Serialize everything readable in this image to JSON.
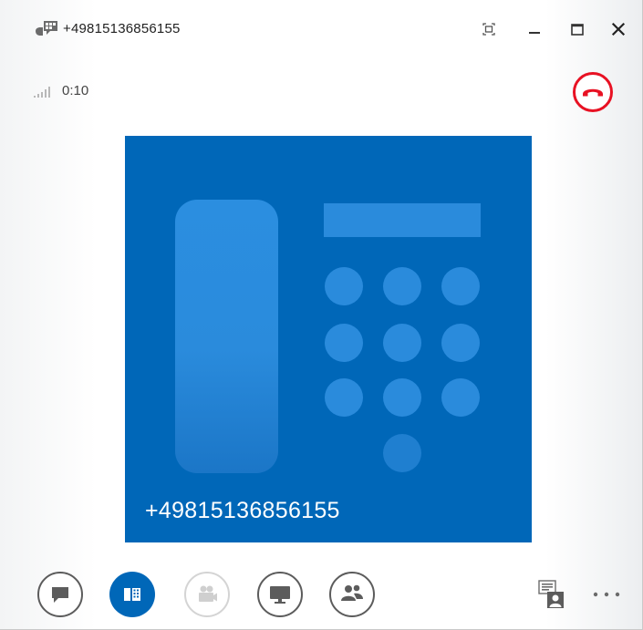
{
  "window": {
    "title": "+49815136856155",
    "icon": "phone-chat-icon",
    "controls": [
      "full-screen-icon",
      "minimize-icon",
      "maximize-icon",
      "close-icon"
    ]
  },
  "status": {
    "signal_icon": "signal-strength-icon",
    "timer": "0:10",
    "hangup_icon": "hang-up-icon",
    "hangup_color": "#e81123"
  },
  "tile": {
    "number": "+49815136856155",
    "background": "#0067b8",
    "art_icon": "desk-phone-icon"
  },
  "toolbar": {
    "buttons": [
      "chat-icon",
      "dialpad-icon",
      "video-icon",
      "present-icon",
      "people-icon"
    ],
    "active": "dialpad-icon",
    "accent": "#0067b8",
    "layout_icon": "layout-options-icon",
    "more_icon": "more-options-icon"
  }
}
